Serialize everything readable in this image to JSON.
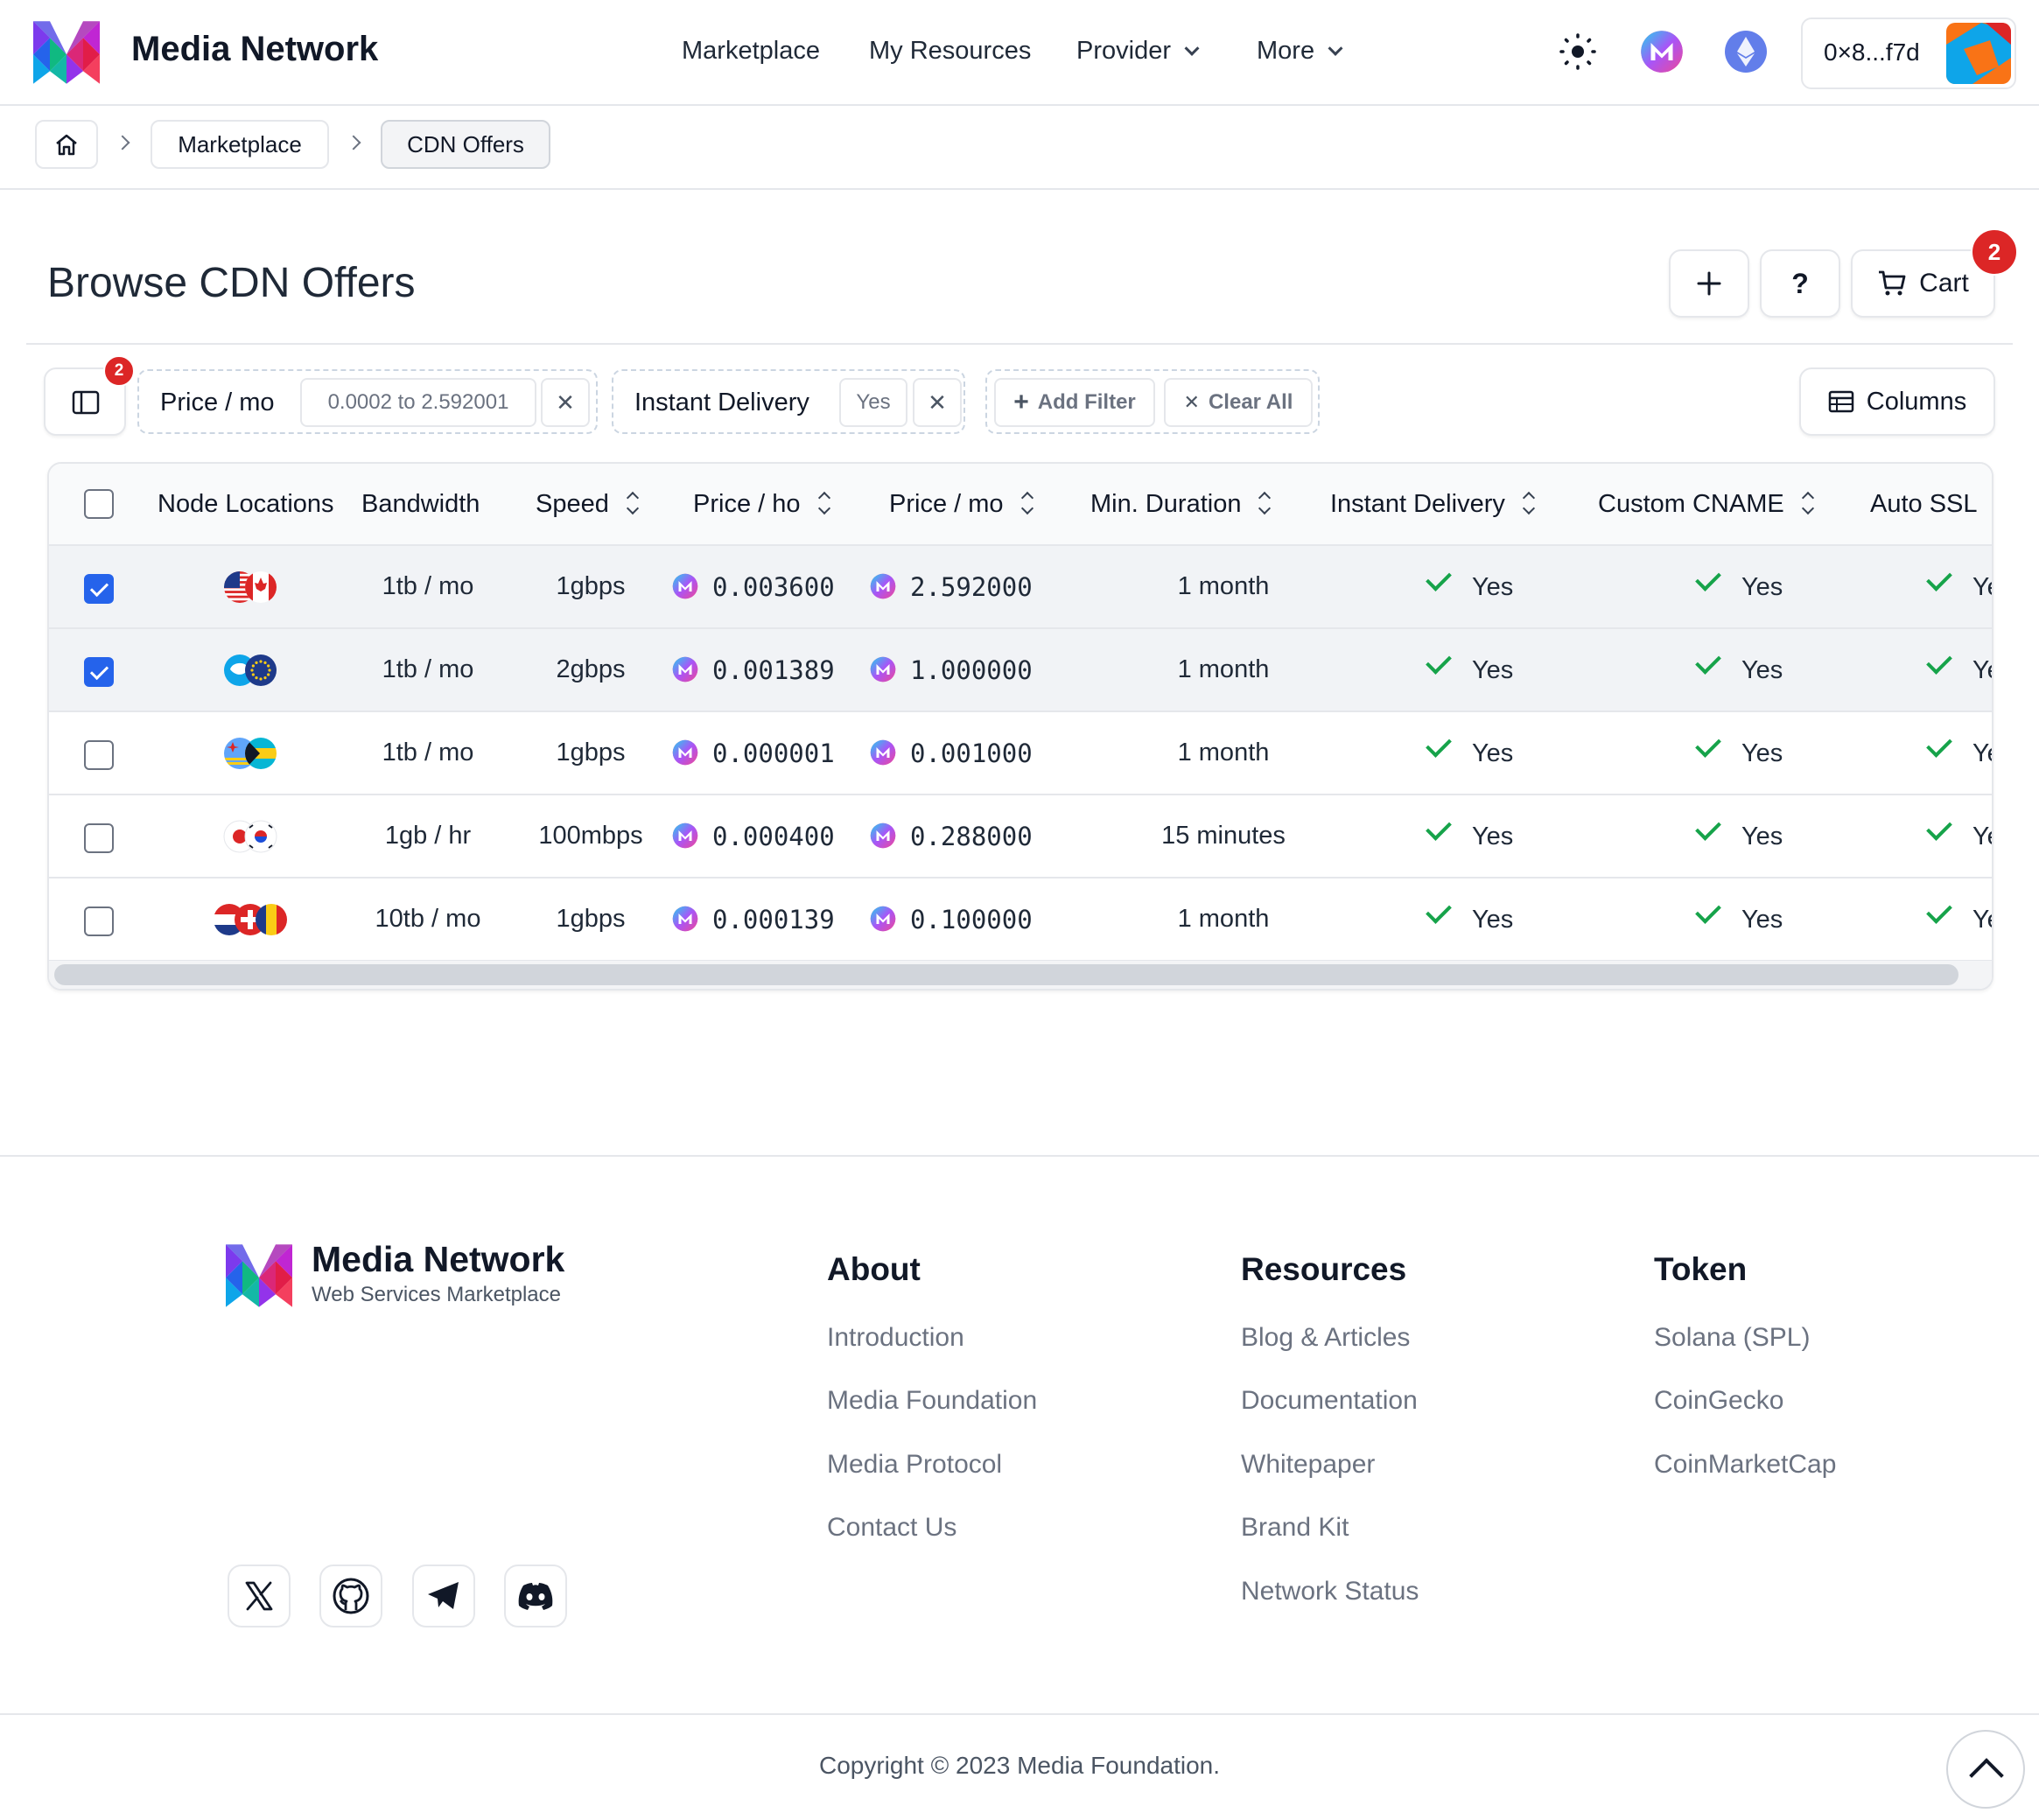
{
  "header": {
    "brand": "Media Network",
    "nav": [
      {
        "label": "Marketplace",
        "dropdown": false
      },
      {
        "label": "My Resources",
        "dropdown": false
      },
      {
        "label": "Provider",
        "dropdown": true
      },
      {
        "label": "More",
        "dropdown": true
      }
    ],
    "icons": [
      "theme-toggle-icon",
      "media-token-icon",
      "ethereum-icon"
    ],
    "wallet_address": "0×8...f7d"
  },
  "breadcrumb": {
    "items": [
      "Marketplace",
      "CDN Offers"
    ]
  },
  "page": {
    "title": "Browse CDN Offers",
    "cart_label": "Cart",
    "cart_count": "2",
    "help_label": "?"
  },
  "filters": {
    "sidebar_badge": "2",
    "groups": [
      {
        "label": "Price / mo",
        "value": "0.0002 to 2.592001"
      },
      {
        "label": "Instant Delivery",
        "value": "Yes"
      }
    ],
    "add_filter_label": "Add Filter",
    "clear_all_label": "Clear All",
    "columns_label": "Columns"
  },
  "table": {
    "columns": [
      "Node Locations",
      "Bandwidth",
      "Speed",
      "Price / ho",
      "Price / mo",
      "Min. Duration",
      "Instant Delivery",
      "Custom CNAME",
      "Auto SSL"
    ],
    "rows": [
      {
        "selected": true,
        "flags": [
          "us",
          "ca"
        ],
        "bandwidth": "1tb / mo",
        "speed": "1gbps",
        "price_ho": "0.003600",
        "price_mo": "2.592000",
        "duration": "1 month",
        "instant": "Yes",
        "cname": "Yes",
        "ssl": "Yes"
      },
      {
        "selected": true,
        "flags": [
          "aq",
          "eu"
        ],
        "bandwidth": "1tb / mo",
        "speed": "2gbps",
        "price_ho": "0.001389",
        "price_mo": "1.000000",
        "duration": "1 month",
        "instant": "Yes",
        "cname": "Yes",
        "ssl": "Yes"
      },
      {
        "selected": false,
        "flags": [
          "aw",
          "bs"
        ],
        "bandwidth": "1tb / mo",
        "speed": "1gbps",
        "price_ho": "0.000001",
        "price_mo": "0.001000",
        "duration": "1 month",
        "instant": "Yes",
        "cname": "Yes",
        "ssl": "Yes"
      },
      {
        "selected": false,
        "flags": [
          "jp",
          "kr"
        ],
        "bandwidth": "1gb / hr",
        "speed": "100mbps",
        "price_ho": "0.000400",
        "price_mo": "0.288000",
        "duration": "15 minutes",
        "instant": "Yes",
        "cname": "Yes",
        "ssl": "Yes"
      },
      {
        "selected": false,
        "flags": [
          "nl",
          "ch",
          "ro"
        ],
        "bandwidth": "10tb / mo",
        "speed": "1gbps",
        "price_ho": "0.000139",
        "price_mo": "0.100000",
        "duration": "1 month",
        "instant": "Yes",
        "cname": "Yes",
        "ssl": "Yes"
      }
    ]
  },
  "footer": {
    "brand": "Media Network",
    "tagline": "Web Services Marketplace",
    "columns": [
      {
        "title": "About",
        "links": [
          "Introduction",
          "Media Foundation",
          "Media Protocol",
          "Contact Us"
        ]
      },
      {
        "title": "Resources",
        "links": [
          "Blog & Articles",
          "Documentation",
          "Whitepaper",
          "Brand Kit",
          "Network Status"
        ]
      },
      {
        "title": "Token",
        "links": [
          "Solana (SPL)",
          "CoinGecko",
          "CoinMarketCap"
        ]
      }
    ],
    "social": [
      "x-icon",
      "github-icon",
      "telegram-icon",
      "discord-icon"
    ],
    "copyright": "Copyright © 2023 Media Foundation."
  },
  "colors": {
    "accent": "#2563eb",
    "badge": "#dc2626",
    "check": "#16a34a",
    "selected_row": "#f1f3f6"
  }
}
